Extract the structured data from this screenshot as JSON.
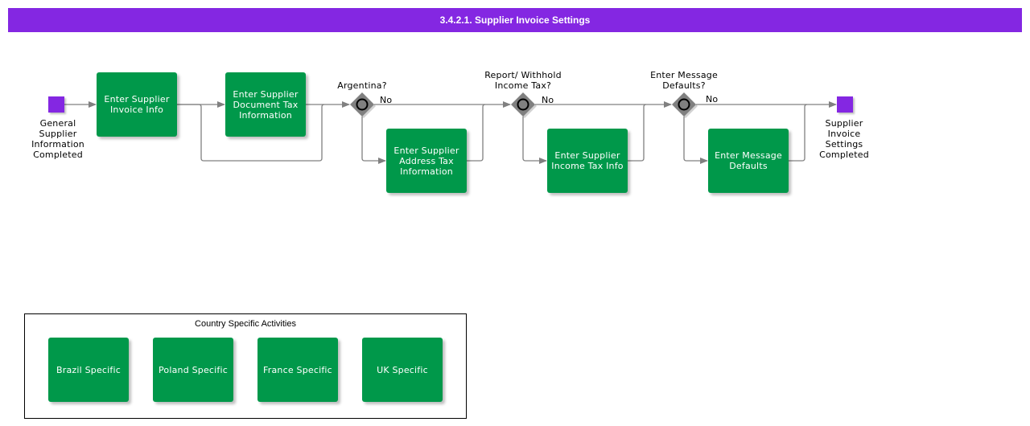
{
  "title": "3.4.2.1. Supplier Invoice Settings",
  "colors": {
    "title_bar": "#8427e2",
    "task": "#00984a",
    "event": "#8427e2",
    "gateway": "#808080",
    "connector": "#808080"
  },
  "events": {
    "start": {
      "label": "General\nSupplier\nInformation\nCompleted",
      "icon": "start-event-square"
    },
    "end": {
      "label": "Supplier\nInvoice\nSettings\nCompleted",
      "icon": "end-event-square"
    }
  },
  "tasks": [
    {
      "id": "t1",
      "label": "Enter Supplier\nInvoice Info"
    },
    {
      "id": "t2",
      "label": "Enter Supplier\nDocument Tax\nInformation"
    },
    {
      "id": "t3",
      "label": "Enter Supplier\nAddress Tax\nInformation"
    },
    {
      "id": "t4",
      "label": "Enter Supplier\nIncome Tax Info"
    },
    {
      "id": "t5",
      "label": "Enter Message\nDefaults"
    }
  ],
  "gateways": [
    {
      "id": "g1",
      "question": "Argentina?",
      "no_label": "No"
    },
    {
      "id": "g2",
      "question": "Report/ Withhold\nIncome Tax?",
      "no_label": "No"
    },
    {
      "id": "g3",
      "question": "Enter Message\nDefaults?",
      "no_label": "No"
    }
  ],
  "legend": {
    "title": "Country Specific Activities",
    "items": [
      {
        "label": "Brazil Specific"
      },
      {
        "label": "Poland Specific"
      },
      {
        "label": "France Specific"
      },
      {
        "label": "UK Specific"
      }
    ]
  }
}
